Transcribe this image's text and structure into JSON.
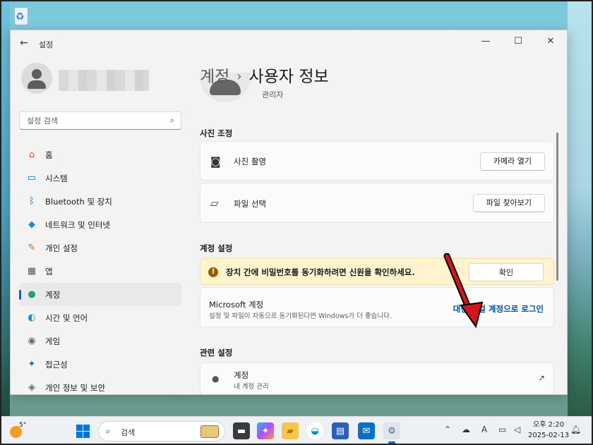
{
  "window": {
    "title": "설정",
    "back_glyph": "←",
    "minimize_glyph": "—",
    "maximize_glyph": "☐",
    "close_glyph": "✕"
  },
  "sidebar": {
    "search_placeholder": "설정 검색",
    "items": [
      {
        "label": "홈",
        "icon": "home-icon",
        "glyph": "⌂",
        "color": "#d9531e"
      },
      {
        "label": "시스템",
        "icon": "system-icon",
        "glyph": "▭",
        "color": "#0078d4"
      },
      {
        "label": "Bluetooth 및 장치",
        "icon": "bluetooth-icon",
        "glyph": "ᛒ",
        "color": "#0a6fd6"
      },
      {
        "label": "네트워크 및 인터넷",
        "icon": "network-icon",
        "glyph": "◆",
        "color": "#2b88d8"
      },
      {
        "label": "개인 설정",
        "icon": "personalization-icon",
        "glyph": "✎",
        "color": "#c46a1f"
      },
      {
        "label": "앱",
        "icon": "apps-icon",
        "glyph": "▦",
        "color": "#4a5a75"
      },
      {
        "label": "계정",
        "icon": "accounts-icon",
        "glyph": "●",
        "color": "#20a37a",
        "active": true
      },
      {
        "label": "시간 및 언어",
        "icon": "time-language-icon",
        "glyph": "◐",
        "color": "#1f8ad1"
      },
      {
        "label": "게임",
        "icon": "gaming-icon",
        "glyph": "◉",
        "color": "#6b6b6b"
      },
      {
        "label": "접근성",
        "icon": "accessibility-icon",
        "glyph": "✦",
        "color": "#0a6fd6"
      },
      {
        "label": "개인 정보 및 보안",
        "icon": "privacy-shield-icon",
        "glyph": "◈",
        "color": "#6b6b6b"
      }
    ]
  },
  "header": {
    "breadcrumb_parent": "계정",
    "breadcrumb_sep": "›",
    "breadcrumb_current": "사용자 정보",
    "role": "관리자"
  },
  "photo": {
    "section_title": "사진 조정",
    "camera_label": "사진 촬영",
    "camera_button": "카메라 열기",
    "file_label": "파일 선택",
    "file_button": "파일 찾아보기"
  },
  "account_settings": {
    "section_title": "계정 설정",
    "warning_text": "장치 간에 비밀번호를 동기화하려면 신원을 확인하세요.",
    "warning_glyph": "!",
    "warning_button": "확인",
    "ms_title": "Microsoft 계정",
    "ms_desc": "설정 및 파일이 자동으로 동기화된다면 Windows가 더 좋습니다.",
    "ms_link": "대신 로컬 계정으로 로그인"
  },
  "related": {
    "section_title": "관련 설정",
    "item_title": "계정",
    "item_sub": "내 계정 관리"
  },
  "taskbar": {
    "temperature": "5°",
    "search_label": "검색",
    "time": "오후 2:20",
    "date": "2025-02-13",
    "ime": "A"
  },
  "colors": {
    "accent": "#0067c0",
    "link": "#0053a3",
    "warning_bg": "#fff4ce",
    "arrow": "#d8141b"
  }
}
